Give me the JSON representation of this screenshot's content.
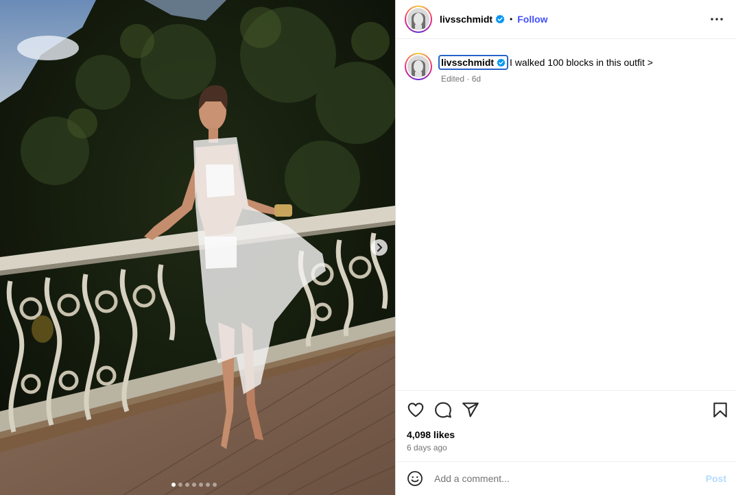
{
  "post": {
    "username": "livsschmidt",
    "verified": true,
    "follow_label": "Follow",
    "separator": "•",
    "caption_text": "I walked 100 blocks in this outfit >",
    "caption_meta": "Edited · 6d",
    "likes": "4,098 likes",
    "time_ago": "6 days ago"
  },
  "media": {
    "carousel_count": 7,
    "active_index": 0,
    "next_icon": "chevron-right-icon"
  },
  "actions": {
    "like_icon": "heart-icon",
    "comment_icon": "comment-icon",
    "share_icon": "send-icon",
    "save_icon": "bookmark-icon",
    "more_icon": "more-horizontal-icon"
  },
  "comment": {
    "placeholder": "Add a comment...",
    "post_label": "Post",
    "emoji_icon": "emoji-icon"
  },
  "colors": {
    "follow": "#4150f7",
    "verified": "#0095f6",
    "post_disabled": "#b3dbff",
    "focus_ring": "#2563c9"
  }
}
